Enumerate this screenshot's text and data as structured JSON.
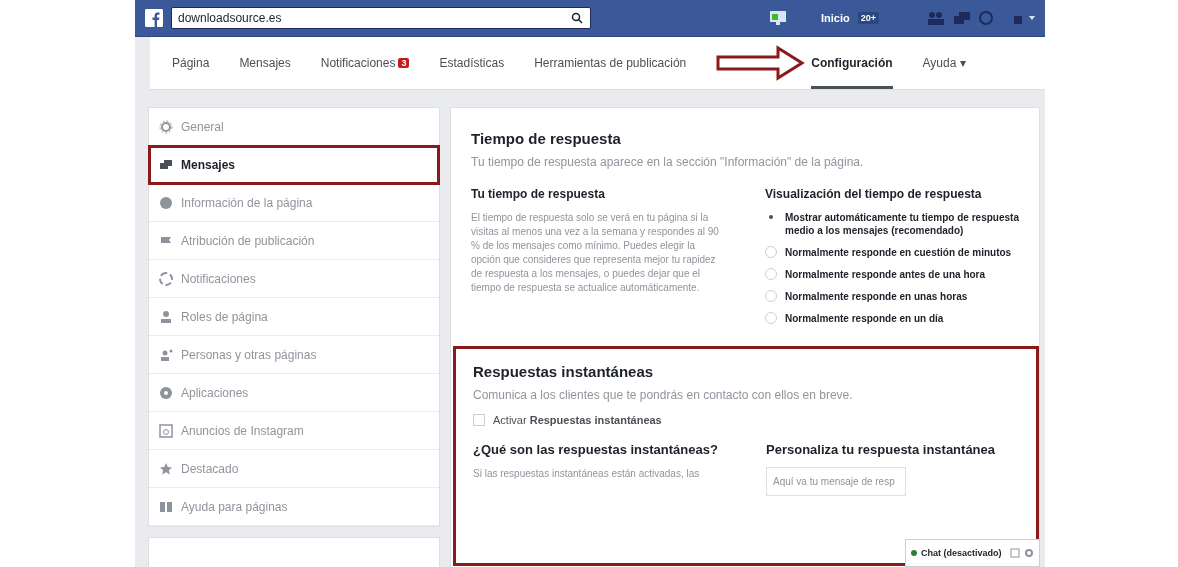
{
  "topbar": {
    "search": {
      "value": "downloadsource.es"
    },
    "home": "Inicio",
    "home_badge": "20+"
  },
  "nav": {
    "tabs": [
      {
        "label": "Página",
        "selected": false,
        "annotated": false
      },
      {
        "label": "Mensajes",
        "selected": false,
        "annotated": false
      },
      {
        "label": "Notificaciones",
        "selected": false,
        "badge": "3",
        "annotated": false
      },
      {
        "label": "Estadísticas",
        "selected": false,
        "annotated": false
      },
      {
        "label": "Herramientas de publicación",
        "selected": false,
        "annotated": false
      },
      {
        "label": "Configuración",
        "selected": true,
        "annotated": true
      },
      {
        "label": "Ayuda ▾",
        "selected": false,
        "annotated": false
      }
    ]
  },
  "sidebar": {
    "items": [
      {
        "label": "General",
        "selected": false,
        "highlighted": false
      },
      {
        "label": "Mensajes",
        "selected": true,
        "highlighted": true
      },
      {
        "label": "Información de la página",
        "selected": false,
        "highlighted": false
      },
      {
        "label": "Atribución de publicación",
        "selected": false,
        "highlighted": false
      },
      {
        "label": "Notificaciones",
        "selected": false,
        "highlighted": false
      },
      {
        "label": "Roles de página",
        "selected": false,
        "highlighted": false
      },
      {
        "label": "Personas y otras páginas",
        "selected": false,
        "highlighted": false
      },
      {
        "label": "Aplicaciones",
        "selected": false,
        "highlighted": false
      },
      {
        "label": "Anuncios de Instagram",
        "selected": false,
        "highlighted": false
      },
      {
        "label": "Destacado",
        "selected": false,
        "highlighted": false
      },
      {
        "label": "Ayuda para páginas",
        "selected": false,
        "highlighted": false
      }
    ]
  },
  "response_time": {
    "title": "Tiempo de respuesta",
    "subtitle": "Tu tiempo de respuesta aparece en la sección \"Información\" de la página.",
    "left": {
      "title": "Tu tiempo de respuesta",
      "text": "El tiempo de respuesta solo se verá en tu página si la visitas al menos una vez a la semana y respondes al 90 % de los mensajes como mínimo. Puedes elegir la opción que consideres que representa mejor tu rapidez de respuesta a los mensajes, o puedes dejar que el tiempo de respuesta se actualice automáticamente."
    },
    "right": {
      "title": "Visualización del tiempo de respuesta",
      "options": [
        {
          "label": "Mostrar automáticamente tu tiempo de respuesta medio a los mensajes (recomendado)",
          "selected": true
        },
        {
          "label": "Normalmente responde en cuestión de minutos",
          "selected": false
        },
        {
          "label": "Normalmente responde antes de una hora",
          "selected": false
        },
        {
          "label": "Normalmente responde en unas horas",
          "selected": false
        },
        {
          "label": "Normalmente responde en un día",
          "selected": false
        }
      ]
    }
  },
  "instant_replies": {
    "highlighted": true,
    "title": "Respuestas instantáneas",
    "subtitle": "Comunica a los clientes que te pondrás en contacto con ellos en breve.",
    "checkbox": {
      "label": "Activar **Respuestas instantáneas**",
      "checked": false
    },
    "left": {
      "title": "¿Qué son las respuestas instantáneas?",
      "text": "Si las respuestas instantáneas están activadas, las"
    },
    "right": {
      "title": "Personaliza tu respuesta instantánea",
      "field": {
        "placeholder": "Aquí va tu mensaje de resp"
      }
    }
  },
  "chat": {
    "label": "Chat (desactivado)",
    "color": "#2e7d32"
  }
}
